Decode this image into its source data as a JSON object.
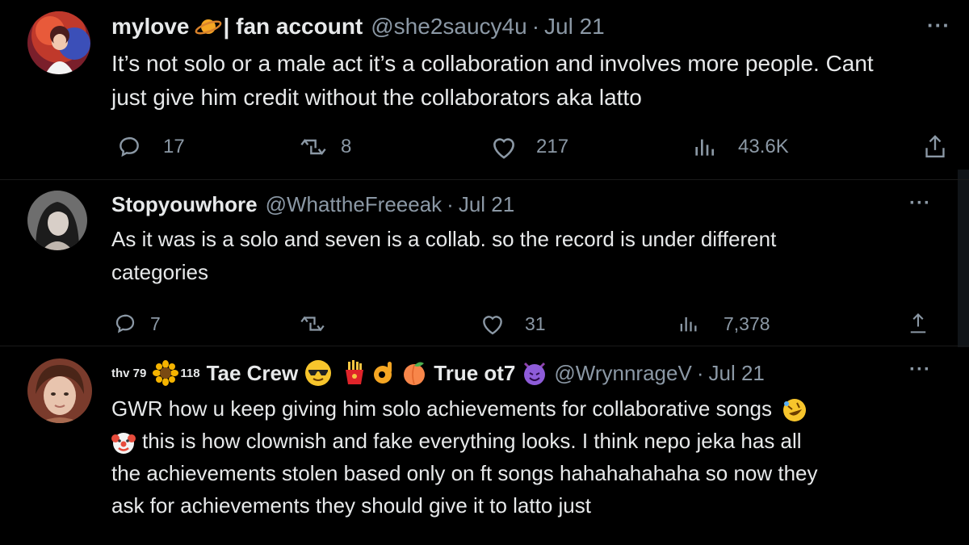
{
  "tweets": [
    {
      "display_name": "mylove",
      "display_name_suffix": "| fan account",
      "handle": "@she2saucy4u",
      "date": "Jul 21",
      "text_lines": [
        "It’s not solo or a male act it’s a collaboration and involves more people. Cant",
        "just give him credit without the collaborators aka latto"
      ],
      "replies": "17",
      "retweets": "8",
      "likes": "217",
      "views": "43.6K"
    },
    {
      "display_name": "Stopyouwhore",
      "handle": "@WhattheFreeeak",
      "date": "Jul 21",
      "text_lines": [
        "As it was is a solo and seven is a collab. so the record  is under different",
        "categories"
      ],
      "replies": "7",
      "retweets": "",
      "likes": "31",
      "views": "7,378"
    },
    {
      "display_name_parts": [
        "thv 79",
        "118",
        "Tae Crew",
        "True ot7"
      ],
      "handle": "@WrynnrageV",
      "date": "Jul 21",
      "text_lines": [
        "GWR how u keep giving him solo achievements for collaborative songs",
        "this is how clownish and fake everything looks.  I think nepo jeka has all",
        "the achievements stolen based only on ft songs hahahahahaha so now they",
        "ask for achievements they should give it to latto just"
      ]
    }
  ],
  "ui": {
    "separator": "·",
    "more": "···"
  },
  "icons": {
    "reply": "reply-icon",
    "retweet": "retweet-icon",
    "like": "heart-icon",
    "views": "views-icon",
    "share": "share-icon"
  },
  "colors": {
    "background": "#000000",
    "text": "#e7e9ea",
    "muted": "#8b98a5"
  }
}
